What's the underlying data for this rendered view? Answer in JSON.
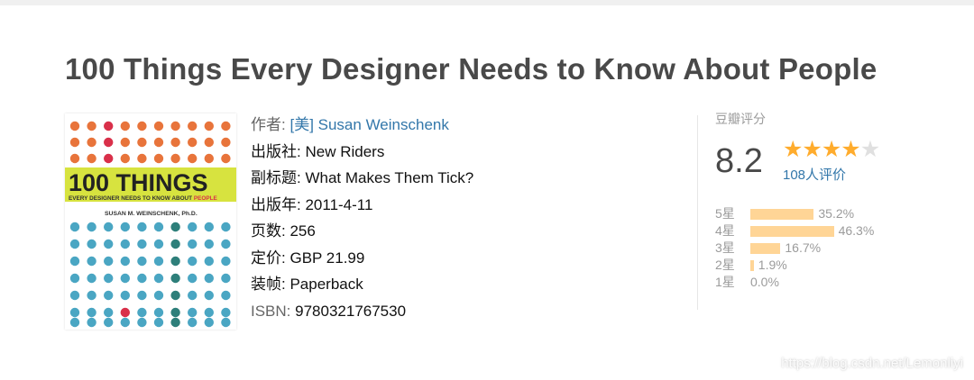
{
  "book": {
    "title": "100 Things Every Designer Needs to Know About People",
    "cover": {
      "headline": "100 THINGS",
      "tagline_prefix": "EVERY DESIGNER NEEDS TO KNOW ABOUT ",
      "tagline_highlight": "PEOPLE",
      "author": "SUSAN M. WEINSCHENK, Ph.D.",
      "colors": {
        "top_dots": "#e8743b",
        "top_accent": "#d9304a",
        "band": "#d7e33f",
        "bottom_dots": "#4aa6c3",
        "bottom_accent": "#2e7f7a",
        "bottom_red": "#d9304a"
      }
    },
    "info": {
      "author_label": "作者:",
      "author_value": "[美] Susan Weinschenk",
      "publisher_label": "出版社:",
      "publisher_value": "New Riders",
      "subtitle_label": "副标题:",
      "subtitle_value": "What Makes Them Tick?",
      "year_label": "出版年:",
      "year_value": "2011-4-11",
      "pages_label": "页数:",
      "pages_value": "256",
      "price_label": "定价:",
      "price_value": "GBP 21.99",
      "binding_label": "装帧:",
      "binding_value": "Paperback",
      "isbn_label": "ISBN:",
      "isbn_value": "9780321767530"
    }
  },
  "rating": {
    "label": "豆瓣评分",
    "score": "8.2",
    "stars_value": 4.1,
    "votes": "108人评价",
    "distribution": [
      {
        "label": "5星",
        "percent": 35.2,
        "text": "35.2%"
      },
      {
        "label": "4星",
        "percent": 46.3,
        "text": "46.3%"
      },
      {
        "label": "3星",
        "percent": 16.7,
        "text": "16.7%"
      },
      {
        "label": "2星",
        "percent": 1.9,
        "text": "1.9%"
      },
      {
        "label": "1星",
        "percent": 0.0,
        "text": "0.0%"
      }
    ]
  },
  "watermark": "https://blog.csdn.net/Lemonliyi"
}
